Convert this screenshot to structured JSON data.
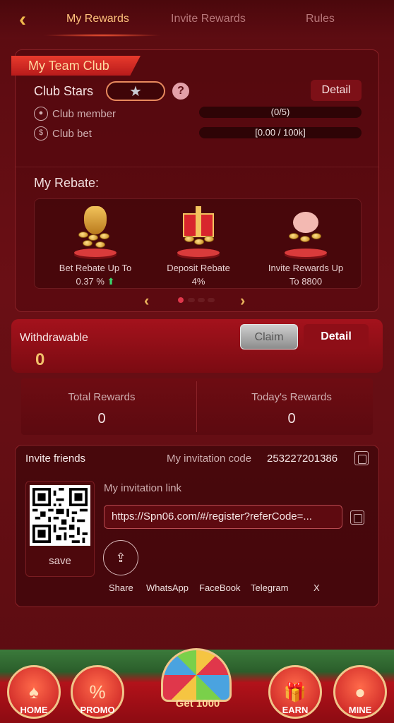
{
  "header": {
    "tabs": [
      {
        "label": "My Rewards",
        "active": true
      },
      {
        "label": "Invite Rewards",
        "active": false
      },
      {
        "label": "Rules",
        "active": false
      }
    ]
  },
  "club": {
    "ribbon": "My Team Club",
    "stars_label": "Club Stars",
    "detail_label": "Detail",
    "member_label": "Club member",
    "member_value": "(0/5)",
    "bet_label": "Club bet",
    "bet_value": "[0.00 / 100k]"
  },
  "rebate": {
    "title": "My Rebate:",
    "items": [
      {
        "caption": "Bet Rebate Up To",
        "value": "0.37 %",
        "trend": "up"
      },
      {
        "caption": "Deposit Rebate",
        "value": "4%"
      },
      {
        "caption": "Invite Rewards Up",
        "value": "To 8800"
      }
    ]
  },
  "withdraw": {
    "label": "Withdrawable",
    "value": "0",
    "claim_label": "Claim",
    "detail_label": "Detail"
  },
  "totals": {
    "total_label": "Total Rewards",
    "total_value": "0",
    "today_label": "Today's Rewards",
    "today_value": "0"
  },
  "invite": {
    "title": "Invite friends",
    "code_label": "My invitation code",
    "code": "253227201386",
    "link_label": "My invitation link",
    "link": "https://Spn06.com/#/register?referCode=...",
    "save_label": "save",
    "share_options": [
      "Share",
      "WhatsApp",
      "FaceBook",
      "Telegram",
      "X"
    ]
  },
  "nav": {
    "items": [
      "HOME",
      "PROMO",
      "EARN",
      "MINE"
    ],
    "center": "Get 1000"
  },
  "colors": {
    "accent": "#ffc27c",
    "bg": "#5e0c12",
    "danger": "#e0374b"
  }
}
